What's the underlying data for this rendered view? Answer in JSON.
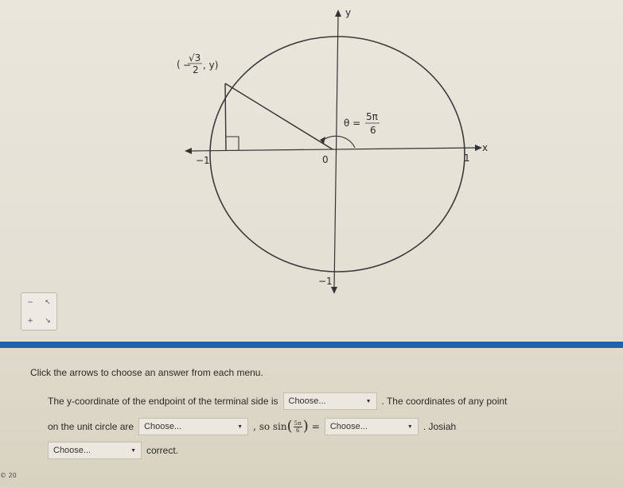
{
  "figure": {
    "point_label_prefix": "(",
    "point_label_x_num": "√3",
    "point_label_x_den": "2",
    "point_label_sign": "−",
    "point_label_suffix": ", y)",
    "angle_label_theta": "θ =",
    "angle_label_num": "5π",
    "angle_label_den": "6",
    "axis_labels": {
      "y_top": "y",
      "x_right": "x",
      "neg_one_x": "−1",
      "one_x": "1",
      "origin": "0",
      "neg_one_y": "−1"
    }
  },
  "toolbox": {
    "cells": [
      "−",
      "↖",
      "+",
      "↘"
    ]
  },
  "question": {
    "instruction": "Click the arrows to choose an answer from each menu.",
    "line1_before": "The y-coordinate of the endpoint of the terminal side is",
    "line1_after": ". The coordinates of any point",
    "line2_before": "on the unit circle are",
    "line2_so": ", so sin",
    "sin_num": "5π",
    "sin_den": "6",
    "equals": "=",
    "line2_after": ". Josiah",
    "line3_after": "correct."
  },
  "dropdowns": {
    "placeholder": "Choose...",
    "short_placeholder": "Choose..."
  },
  "colors": {
    "divider": "#1f63a8",
    "figure_bg": "#e6e2d8",
    "question_bg": "#dbd6c6"
  },
  "icons": {
    "caret": "chevron-down-icon"
  },
  "footer": {
    "corner_text": "© 20"
  }
}
